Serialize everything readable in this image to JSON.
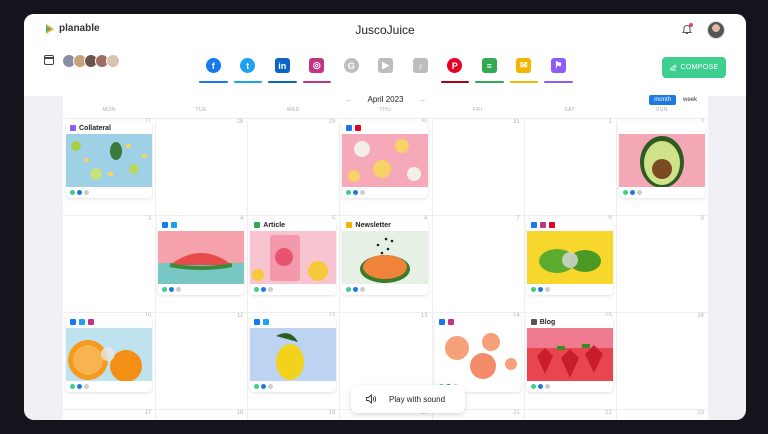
{
  "app": {
    "logo_text": "planable",
    "workspace_title": "JuscoJuice"
  },
  "header": {
    "channels": [
      {
        "name": "facebook",
        "glyph": "f",
        "bg": "#1877f2",
        "underline": "#1877f2",
        "round": true
      },
      {
        "name": "twitter",
        "glyph": "t",
        "bg": "#1da1f2",
        "underline": "#1da1f2",
        "round": true
      },
      {
        "name": "linkedin",
        "glyph": "in",
        "bg": "#0a66c2",
        "underline": "#0a66c2",
        "round": false
      },
      {
        "name": "instagram",
        "glyph": "◎",
        "bg": "#c13584",
        "underline": "#c13584",
        "round": false
      },
      {
        "name": "google",
        "glyph": "G",
        "bg": "#bdbdbd",
        "underline": "",
        "round": true
      },
      {
        "name": "youtube",
        "glyph": "▶",
        "bg": "#bdbdbd",
        "underline": "",
        "round": false
      },
      {
        "name": "tiktok",
        "glyph": "♪",
        "bg": "#bdbdbd",
        "underline": "",
        "round": false
      },
      {
        "name": "pinterest",
        "glyph": "P",
        "bg": "#e60023",
        "underline": "#b20018",
        "round": true
      },
      {
        "name": "google-docs",
        "glyph": "≡",
        "bg": "#34a853",
        "underline": "#34a853",
        "round": false
      },
      {
        "name": "email",
        "glyph": "✉",
        "bg": "#f4b400",
        "underline": "#f4b400",
        "round": false
      },
      {
        "name": "universal",
        "glyph": "⚑",
        "bg": "#8e5cf7",
        "underline": "#8e5cf7",
        "round": false
      }
    ],
    "compose_label": "COMPOSE",
    "avatar_colors": [
      "#8a8fa0",
      "#c7a17a",
      "#6b5548",
      "#a06d66",
      "#d8c2b0"
    ]
  },
  "calendar": {
    "month_label": "April 2023",
    "view_month": "month",
    "view_week": "week",
    "weekdays": [
      "MON",
      "TUE",
      "WED",
      "THU",
      "FRI",
      "SAT",
      "SUN"
    ],
    "day_numbers": [
      [
        "27",
        "28",
        "29",
        "30",
        "31",
        "1",
        "2"
      ],
      [
        "3",
        "4",
        "5",
        "6",
        "7",
        "8",
        "9"
      ],
      [
        "10",
        "11",
        "12",
        "13",
        "14",
        "15",
        "16"
      ],
      [
        "17",
        "18",
        "19",
        "20",
        "21",
        "22",
        "23"
      ]
    ]
  },
  "posts": [
    {
      "row": 0,
      "col": 0,
      "title": "Collateral",
      "tag_color": "#8e5cf7",
      "icons": [],
      "img": "limes-pineapple"
    },
    {
      "row": 0,
      "col": 3,
      "title": "",
      "tag_color": "",
      "icons": [
        "#1877f2",
        "#e60023"
      ],
      "img": "grapefruit-slices"
    },
    {
      "row": 0,
      "col": 6,
      "title": "",
      "tag_color": "",
      "icons": [],
      "img": "avocado"
    },
    {
      "row": 1,
      "col": 1,
      "title": "",
      "tag_color": "",
      "icons": [
        "#1877f2",
        "#1da1f2"
      ],
      "img": "watermelon"
    },
    {
      "row": 1,
      "col": 2,
      "title": "Article",
      "tag_color": "#34a853",
      "icons": [],
      "img": "pink-drink"
    },
    {
      "row": 1,
      "col": 3,
      "title": "Newsletter",
      "tag_color": "#f4b400",
      "icons": [],
      "img": "papaya"
    },
    {
      "row": 1,
      "col": 5,
      "title": "",
      "tag_color": "",
      "icons": [
        "#1877f2",
        "#c13584",
        "#e60023"
      ],
      "img": "limes-yellow"
    },
    {
      "row": 2,
      "col": 0,
      "title": "",
      "tag_color": "",
      "icons": [
        "#1877f2",
        "#1da1f2",
        "#c13584"
      ],
      "img": "oranges"
    },
    {
      "row": 2,
      "col": 2,
      "title": "",
      "tag_color": "",
      "icons": [
        "#1877f2",
        "#1da1f2"
      ],
      "img": "lemon-blue"
    },
    {
      "row": 2,
      "col": 4,
      "title": "",
      "tag_color": "",
      "icons": [
        "#1877f2",
        "#c13584"
      ],
      "img": "grapefruit-white"
    },
    {
      "row": 2,
      "col": 5,
      "title": "Blog",
      "tag_color": "#555555",
      "icons": [],
      "img": "strawberries"
    }
  ],
  "toast": {
    "label": "Play with sound"
  }
}
